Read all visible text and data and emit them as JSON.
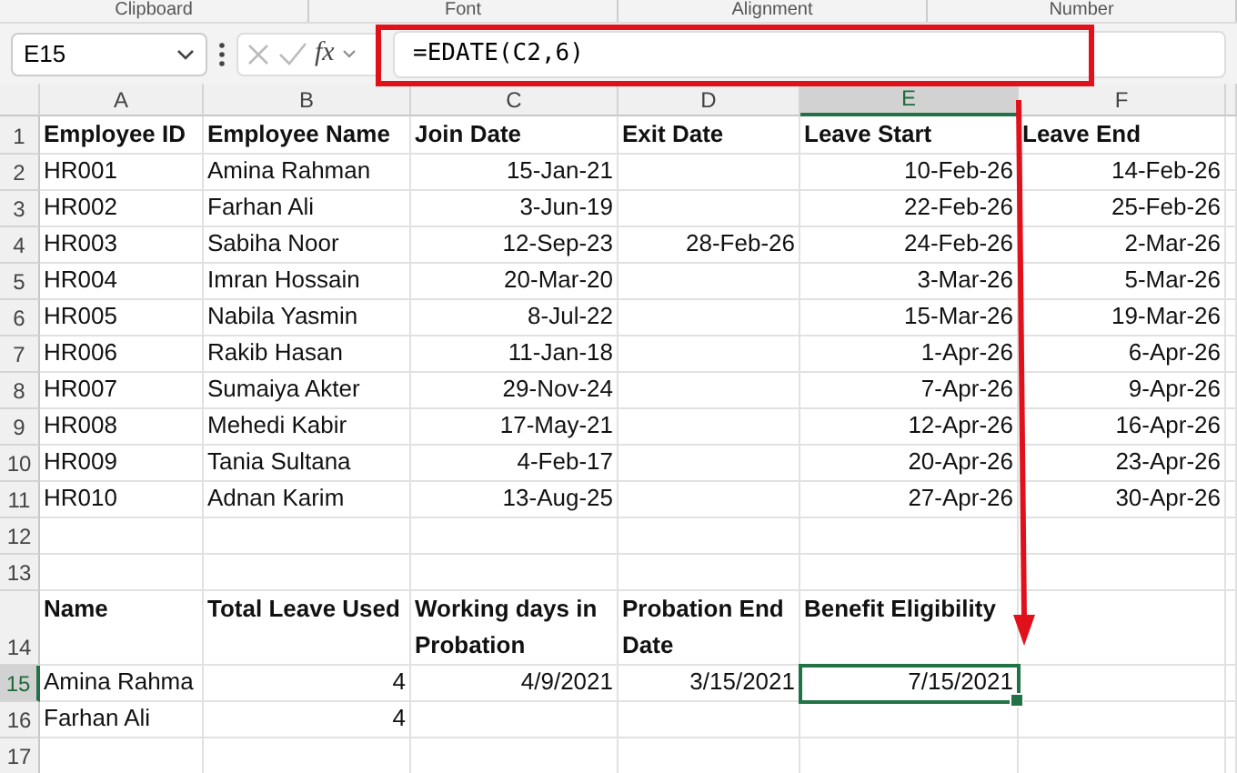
{
  "ribbon_groups": [
    "Clipboard",
    "Font",
    "Alignment",
    "Number"
  ],
  "name_box": "E15",
  "function_label": "fx",
  "formula": "=EDATE(C2,6)",
  "columns": [
    {
      "label": "A",
      "selected": false
    },
    {
      "label": "B",
      "selected": false
    },
    {
      "label": "C",
      "selected": false
    },
    {
      "label": "D",
      "selected": false
    },
    {
      "label": "E",
      "selected": true
    },
    {
      "label": "F",
      "selected": false
    }
  ],
  "rows": [
    {
      "number": "1",
      "selected": false,
      "cells": [
        {
          "text": "Employee ID",
          "kind": "heading",
          "selected": false
        },
        {
          "text": "Employee Name",
          "kind": "heading",
          "selected": false
        },
        {
          "text": "Join Date",
          "kind": "heading",
          "selected": false
        },
        {
          "text": "Exit Date",
          "kind": "heading",
          "selected": false
        },
        {
          "text": "Leave Start",
          "kind": "heading",
          "selected": false
        },
        {
          "text": "Leave End",
          "kind": "heading",
          "selected": false
        }
      ]
    },
    {
      "number": "2",
      "selected": false,
      "cells": [
        {
          "text": "HR001",
          "kind": "text",
          "selected": false
        },
        {
          "text": "Amina Rahman",
          "kind": "text",
          "selected": false
        },
        {
          "text": "15-Jan-21",
          "kind": "number",
          "selected": false
        },
        null,
        {
          "text": "10-Feb-26",
          "kind": "number",
          "selected": false
        },
        {
          "text": "14-Feb-26",
          "kind": "number",
          "selected": false
        }
      ]
    },
    {
      "number": "3",
      "selected": false,
      "cells": [
        {
          "text": "HR002",
          "kind": "text",
          "selected": false
        },
        {
          "text": "Farhan Ali",
          "kind": "text",
          "selected": false
        },
        {
          "text": "3-Jun-19",
          "kind": "number",
          "selected": false
        },
        null,
        {
          "text": "22-Feb-26",
          "kind": "number",
          "selected": false
        },
        {
          "text": "25-Feb-26",
          "kind": "number",
          "selected": false
        }
      ]
    },
    {
      "number": "4",
      "selected": false,
      "cells": [
        {
          "text": "HR003",
          "kind": "text",
          "selected": false
        },
        {
          "text": "Sabiha Noor",
          "kind": "text",
          "selected": false
        },
        {
          "text": "12-Sep-23",
          "kind": "number",
          "selected": false
        },
        {
          "text": "28-Feb-26",
          "kind": "number",
          "selected": false
        },
        {
          "text": "24-Feb-26",
          "kind": "number",
          "selected": false
        },
        {
          "text": "2-Mar-26",
          "kind": "number",
          "selected": false
        }
      ]
    },
    {
      "number": "5",
      "selected": false,
      "cells": [
        {
          "text": "HR004",
          "kind": "text",
          "selected": false
        },
        {
          "text": "Imran Hossain",
          "kind": "text",
          "selected": false
        },
        {
          "text": "20-Mar-20",
          "kind": "number",
          "selected": false
        },
        null,
        {
          "text": "3-Mar-26",
          "kind": "number",
          "selected": false
        },
        {
          "text": "5-Mar-26",
          "kind": "number",
          "selected": false
        }
      ]
    },
    {
      "number": "6",
      "selected": false,
      "cells": [
        {
          "text": "HR005",
          "kind": "text",
          "selected": false
        },
        {
          "text": "Nabila Yasmin",
          "kind": "text",
          "selected": false
        },
        {
          "text": "8-Jul-22",
          "kind": "number",
          "selected": false
        },
        null,
        {
          "text": "15-Mar-26",
          "kind": "number",
          "selected": false
        },
        {
          "text": "19-Mar-26",
          "kind": "number",
          "selected": false
        }
      ]
    },
    {
      "number": "7",
      "selected": false,
      "cells": [
        {
          "text": "HR006",
          "kind": "text",
          "selected": false
        },
        {
          "text": "Rakib Hasan",
          "kind": "text",
          "selected": false
        },
        {
          "text": "11-Jan-18",
          "kind": "number",
          "selected": false
        },
        null,
        {
          "text": "1-Apr-26",
          "kind": "number",
          "selected": false
        },
        {
          "text": "6-Apr-26",
          "kind": "number",
          "selected": false
        }
      ]
    },
    {
      "number": "8",
      "selected": false,
      "cells": [
        {
          "text": "HR007",
          "kind": "text",
          "selected": false
        },
        {
          "text": "Sumaiya Akter",
          "kind": "text",
          "selected": false
        },
        {
          "text": "29-Nov-24",
          "kind": "number",
          "selected": false
        },
        null,
        {
          "text": "7-Apr-26",
          "kind": "number",
          "selected": false
        },
        {
          "text": "9-Apr-26",
          "kind": "number",
          "selected": false
        }
      ]
    },
    {
      "number": "9",
      "selected": false,
      "cells": [
        {
          "text": "HR008",
          "kind": "text",
          "selected": false
        },
        {
          "text": "Mehedi Kabir",
          "kind": "text",
          "selected": false
        },
        {
          "text": "17-May-21",
          "kind": "number",
          "selected": false
        },
        null,
        {
          "text": "12-Apr-26",
          "kind": "number",
          "selected": false
        },
        {
          "text": "16-Apr-26",
          "kind": "number",
          "selected": false
        }
      ]
    },
    {
      "number": "10",
      "selected": false,
      "cells": [
        {
          "text": "HR009",
          "kind": "text",
          "selected": false
        },
        {
          "text": "Tania Sultana",
          "kind": "text",
          "selected": false
        },
        {
          "text": "4-Feb-17",
          "kind": "number",
          "selected": false
        },
        null,
        {
          "text": "20-Apr-26",
          "kind": "number",
          "selected": false
        },
        {
          "text": "23-Apr-26",
          "kind": "number",
          "selected": false
        }
      ]
    },
    {
      "number": "11",
      "selected": false,
      "cells": [
        {
          "text": "HR010",
          "kind": "text",
          "selected": false
        },
        {
          "text": "Adnan Karim",
          "kind": "text",
          "selected": false
        },
        {
          "text": "13-Aug-25",
          "kind": "number",
          "selected": false
        },
        null,
        {
          "text": "27-Apr-26",
          "kind": "number",
          "selected": false
        },
        {
          "text": "30-Apr-26",
          "kind": "number",
          "selected": false
        }
      ]
    },
    {
      "number": "12",
      "selected": false,
      "cells": [
        null,
        null,
        null,
        null,
        null,
        null
      ]
    },
    {
      "number": "13",
      "selected": false,
      "cells": [
        null,
        null,
        null,
        null,
        null,
        null
      ]
    },
    {
      "number": "14",
      "selected": false,
      "cells": [
        {
          "text": "Name",
          "kind": "heading",
          "selected": false
        },
        {
          "text": "Total Leave Used",
          "kind": "heading",
          "selected": false
        },
        {
          "text": "Working days in Probation",
          "kind": "heading",
          "selected": false
        },
        {
          "text": "Probation End Date",
          "kind": "heading",
          "selected": false
        },
        {
          "text": "Benefit Eligibility",
          "kind": "heading",
          "selected": false
        },
        null
      ]
    },
    {
      "number": "15",
      "selected": true,
      "cells": [
        {
          "text": "Amina Rahma",
          "kind": "text",
          "selected": false
        },
        {
          "text": "4",
          "kind": "number",
          "selected": false
        },
        {
          "text": "4/9/2021",
          "kind": "number",
          "selected": false
        },
        {
          "text": "3/15/2021",
          "kind": "number",
          "selected": false
        },
        {
          "text": "7/15/2021",
          "kind": "number",
          "selected": true
        },
        null
      ]
    },
    {
      "number": "16",
      "selected": false,
      "cells": [
        {
          "text": "Farhan Ali",
          "kind": "text",
          "selected": false
        },
        {
          "text": "4",
          "kind": "number",
          "selected": false
        },
        null,
        null,
        null,
        null
      ]
    },
    {
      "number": "17",
      "selected": false,
      "cells": [
        null,
        null,
        null,
        null,
        null,
        null
      ]
    }
  ]
}
